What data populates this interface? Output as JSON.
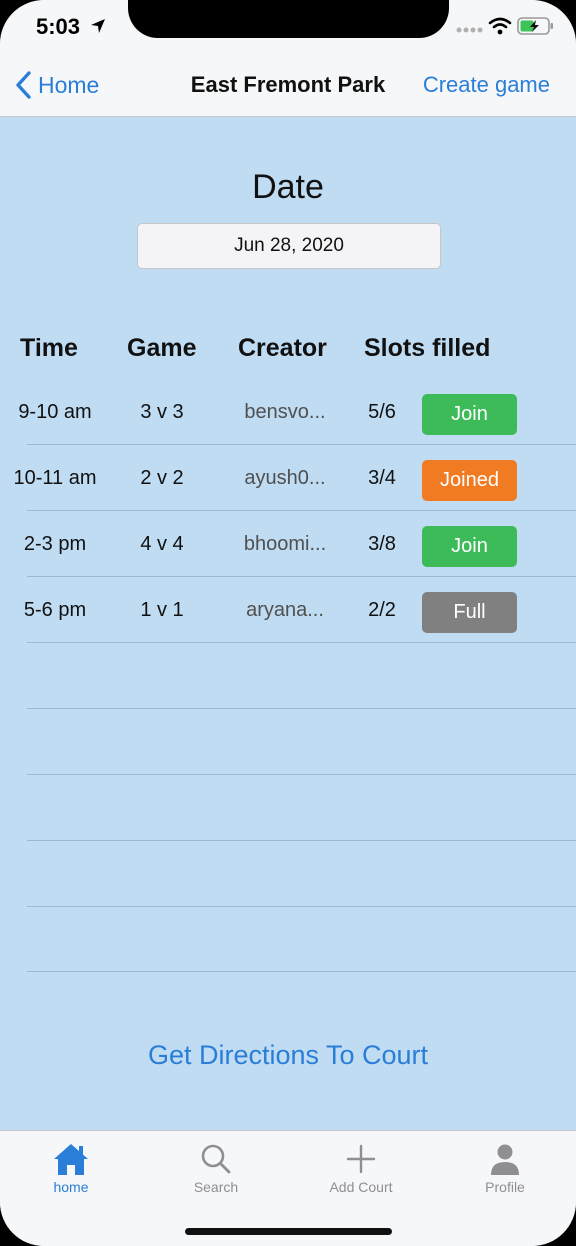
{
  "status": {
    "time": "5:03"
  },
  "nav": {
    "back": "Home",
    "title": "East Fremont Park",
    "action": "Create game"
  },
  "date": {
    "label": "Date",
    "value": "Jun 28, 2020"
  },
  "table": {
    "headers": [
      "Time",
      "Game",
      "Creator",
      "Slots filled"
    ],
    "rows": [
      {
        "time": "9-10 am",
        "game": "3 v 3",
        "creator": "bensvo...",
        "slots": "5/6",
        "action": "Join",
        "color": "#3dbb59"
      },
      {
        "time": "10-11 am",
        "game": "2 v 2",
        "creator": "ayush0...",
        "slots": "3/4",
        "action": "Joined",
        "color": "#f07b23"
      },
      {
        "time": "2-3 pm",
        "game": "4 v 4",
        "creator": "bhoomi...",
        "slots": "3/8",
        "action": "Join",
        "color": "#3dbb59"
      },
      {
        "time": "5-6 pm",
        "game": "1 v 1",
        "creator": "aryana...",
        "slots": "2/2",
        "action": "Full",
        "color": "#808080"
      }
    ]
  },
  "directions": "Get Directions To Court",
  "tabs": [
    {
      "label": "home",
      "icon": "house-icon",
      "active": true
    },
    {
      "label": "Search",
      "icon": "search-icon",
      "active": false
    },
    {
      "label": "Add Court",
      "icon": "plus-icon",
      "active": false
    },
    {
      "label": "Profile",
      "icon": "person-icon",
      "active": false
    }
  ],
  "colors": {
    "accent": "#2a7ed8",
    "background": "#bfdcf3",
    "join": "#3dbb59",
    "joined": "#f07b23",
    "full": "#808080"
  }
}
